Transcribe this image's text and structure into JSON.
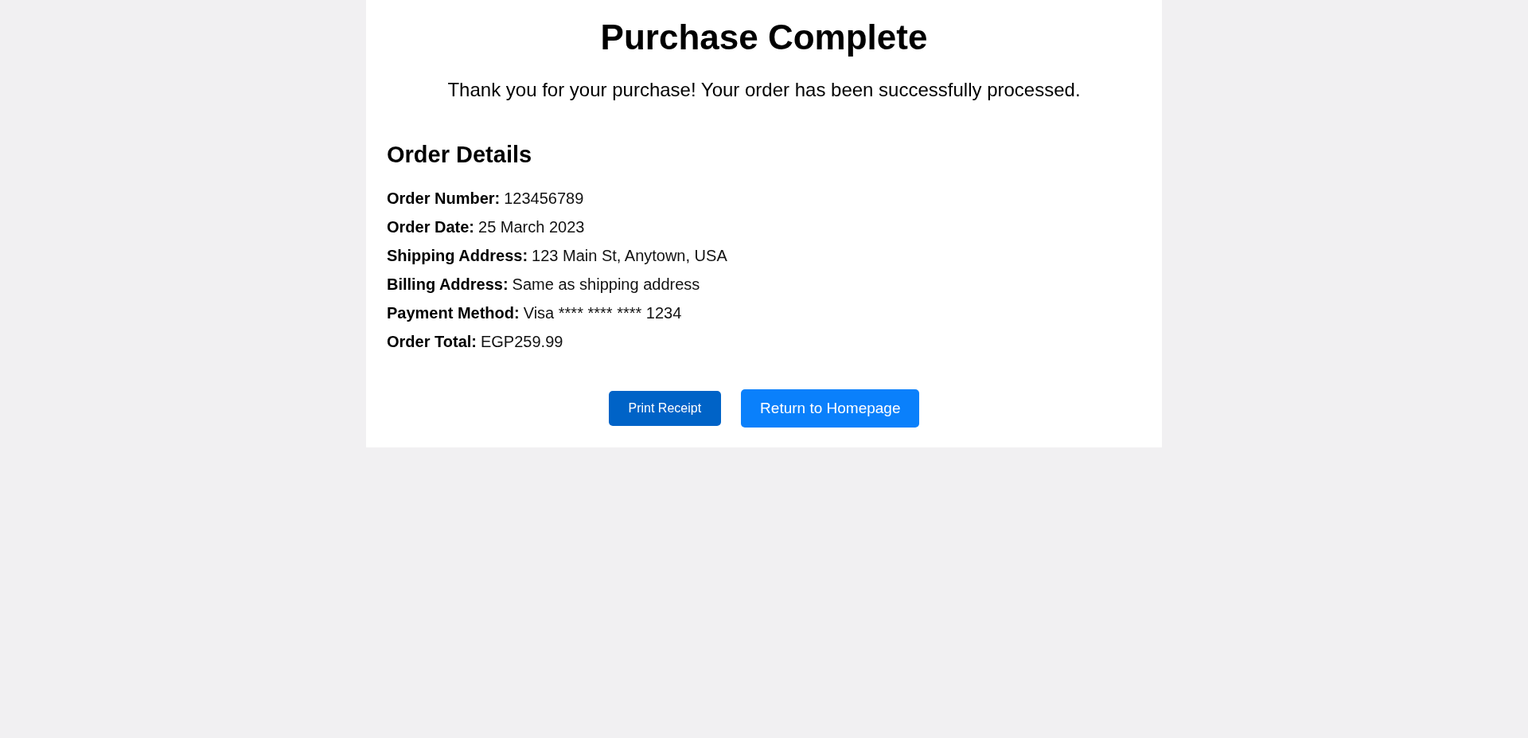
{
  "header": {
    "title": "Purchase Complete",
    "message": "Thank you for your purchase! Your order has been successfully processed."
  },
  "order_details": {
    "heading": "Order Details",
    "fields": [
      {
        "label": "Order Number:",
        "value": "123456789"
      },
      {
        "label": "Order Date:",
        "value": "25 March 2023"
      },
      {
        "label": "Shipping Address:",
        "value": "123 Main St, Anytown, USA"
      },
      {
        "label": "Billing Address:",
        "value": "Same as shipping address"
      },
      {
        "label": "Payment Method:",
        "value": "Visa **** **** **** 1234"
      },
      {
        "label": "Order Total:",
        "value": "EGP259.99"
      }
    ]
  },
  "buttons": [
    {
      "label": "Print Receipt",
      "kind": "secondary"
    },
    {
      "label": "Return to Homepage",
      "kind": "primary"
    }
  ]
}
